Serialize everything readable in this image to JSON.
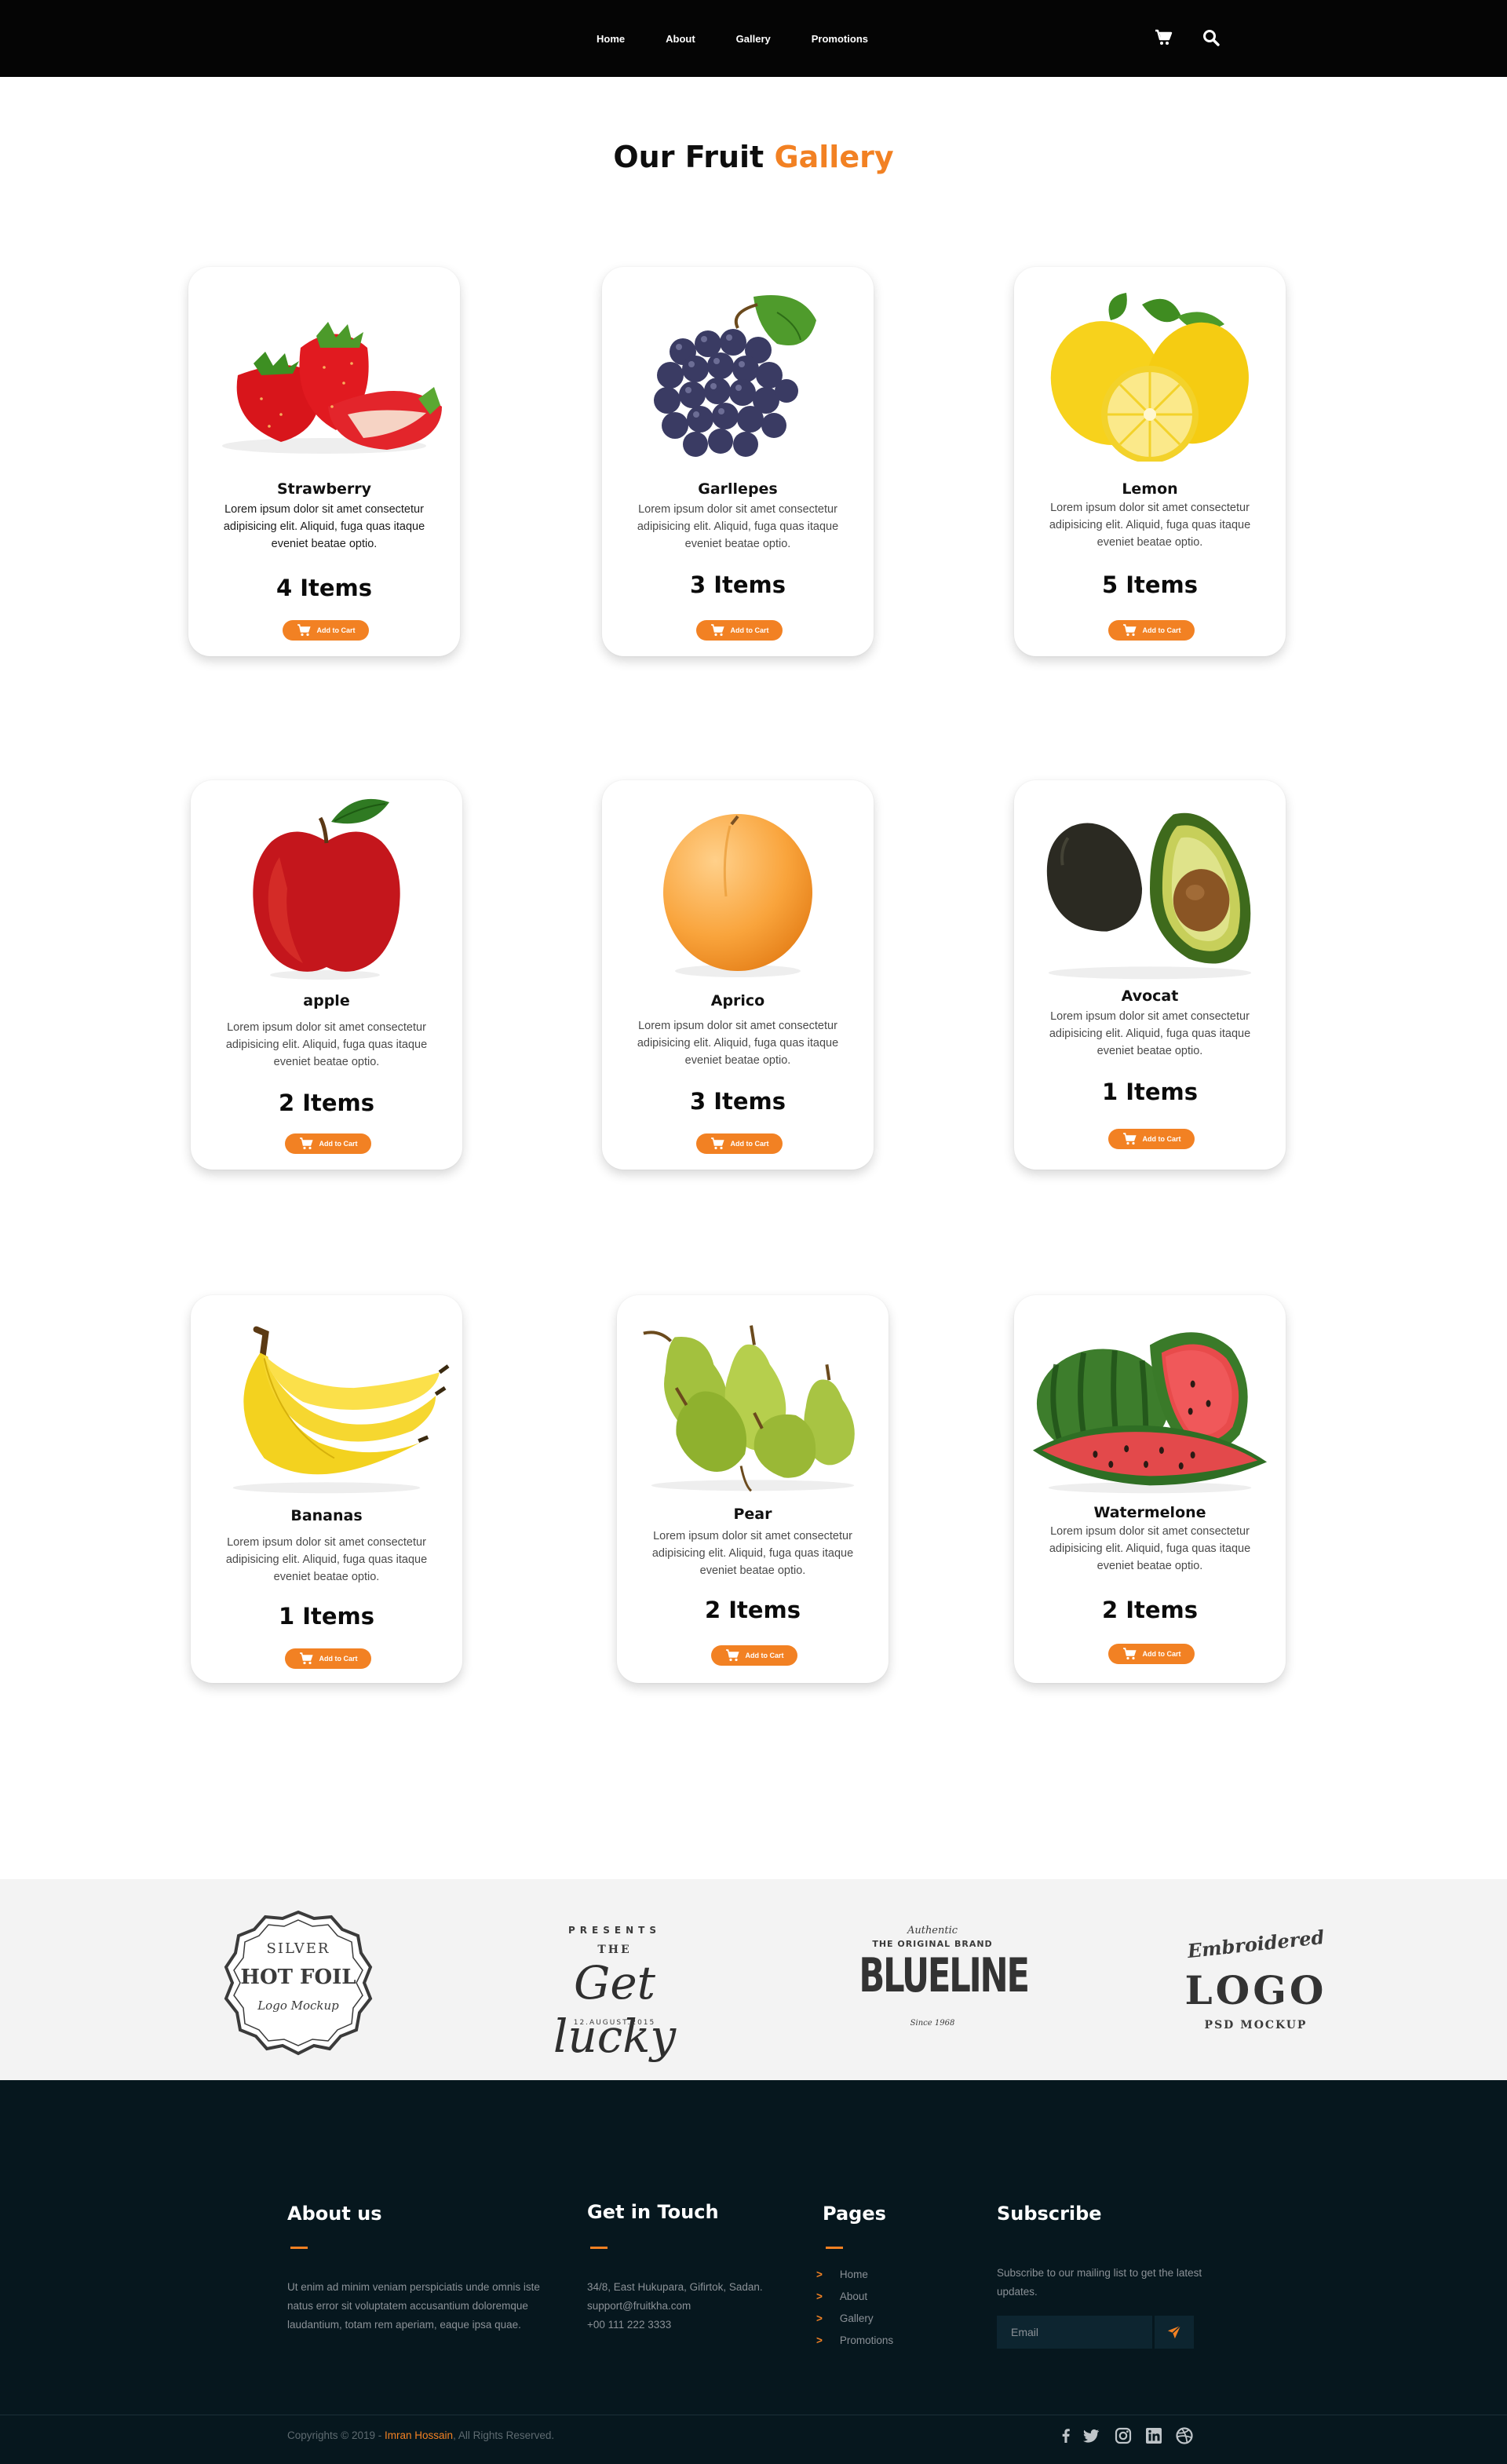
{
  "nav": {
    "links": [
      "Home",
      "About",
      "Gallery",
      "Promotions"
    ],
    "icons": [
      "cart-icon",
      "search-icon"
    ]
  },
  "gallery": {
    "title_main": "Our Fruit",
    "title_accent": "Gallery"
  },
  "products": [
    {
      "name": "Strawberry",
      "qty": "4 Items",
      "icon": "strawberry-image"
    },
    {
      "name": "Garllepes",
      "qty": "3 Items",
      "icon": "grapes-image"
    },
    {
      "name": "Lemon",
      "qty": "5 Items",
      "icon": "lemon-image"
    },
    {
      "name": "apple",
      "qty": "2 Items",
      "icon": "apple-image"
    },
    {
      "name": "Aprico",
      "qty": "3 Items",
      "icon": "apricot-image"
    },
    {
      "name": "Avocat",
      "qty": "1 Items",
      "icon": "avocado-image"
    },
    {
      "name": "Bananas",
      "qty": "1 Items",
      "icon": "bananas-image"
    },
    {
      "name": "Pear",
      "qty": "2 Items",
      "icon": "pear-image"
    },
    {
      "name": "Watermelone",
      "qty": "2 Items",
      "icon": "watermelon-image"
    }
  ],
  "product_desc": "Lorem ipsum dolor sit amet consectetur adipisicing elit. Aliquid, fuga quas itaque eveniet beatae optio.",
  "add_to_cart_label": "Add to Cart",
  "brands": [
    {
      "top": "SILVER",
      "main": "HOT FOIL",
      "sub": "Logo Mockup"
    },
    {
      "top": "PRESENTS",
      "mid": "THE",
      "main": "Get lucky",
      "sub": "12.AUGUST.2015"
    },
    {
      "top": "Authentic",
      "mid": "THE ORIGINAL BRAND",
      "main": "BLUELINE",
      "sub": "Since 1968"
    },
    {
      "top": "Embroidered",
      "main": "LOGO",
      "sub": "PSD MOCKUP"
    }
  ],
  "footer": {
    "about": {
      "heading": "About us",
      "text": "Ut enim ad minim veniam perspiciatis unde omnis iste natus error sit voluptatem accusantium doloremque laudantium, totam rem aperiam, eaque ipsa quae."
    },
    "contact": {
      "heading": "Get in Touch",
      "address": "34/8, East Hukupara, Gifirtok, Sadan.",
      "email": "support@fruitkha.com",
      "phone": "+00 111 222 3333"
    },
    "pages": {
      "heading": "Pages",
      "links": [
        "Home",
        "About",
        "Gallery",
        "Promotions"
      ]
    },
    "subscribe": {
      "heading": "Subscribe",
      "text": "Subscribe to our mailing list to get the latest updates.",
      "placeholder": "Email"
    },
    "copyright_prefix": "Copyrights © 2019 -",
    "copyright_name": "Imran Hossain",
    "copyright_suffix": ", All Rights Reserved.",
    "social_icons": [
      "facebook-icon",
      "twitter-icon",
      "instagram-icon",
      "linkedin-icon",
      "dribbble-icon"
    ]
  },
  "colors": {
    "accent": "#f28123",
    "nav_bg": "#050505",
    "footer_bg": "#06171e"
  }
}
